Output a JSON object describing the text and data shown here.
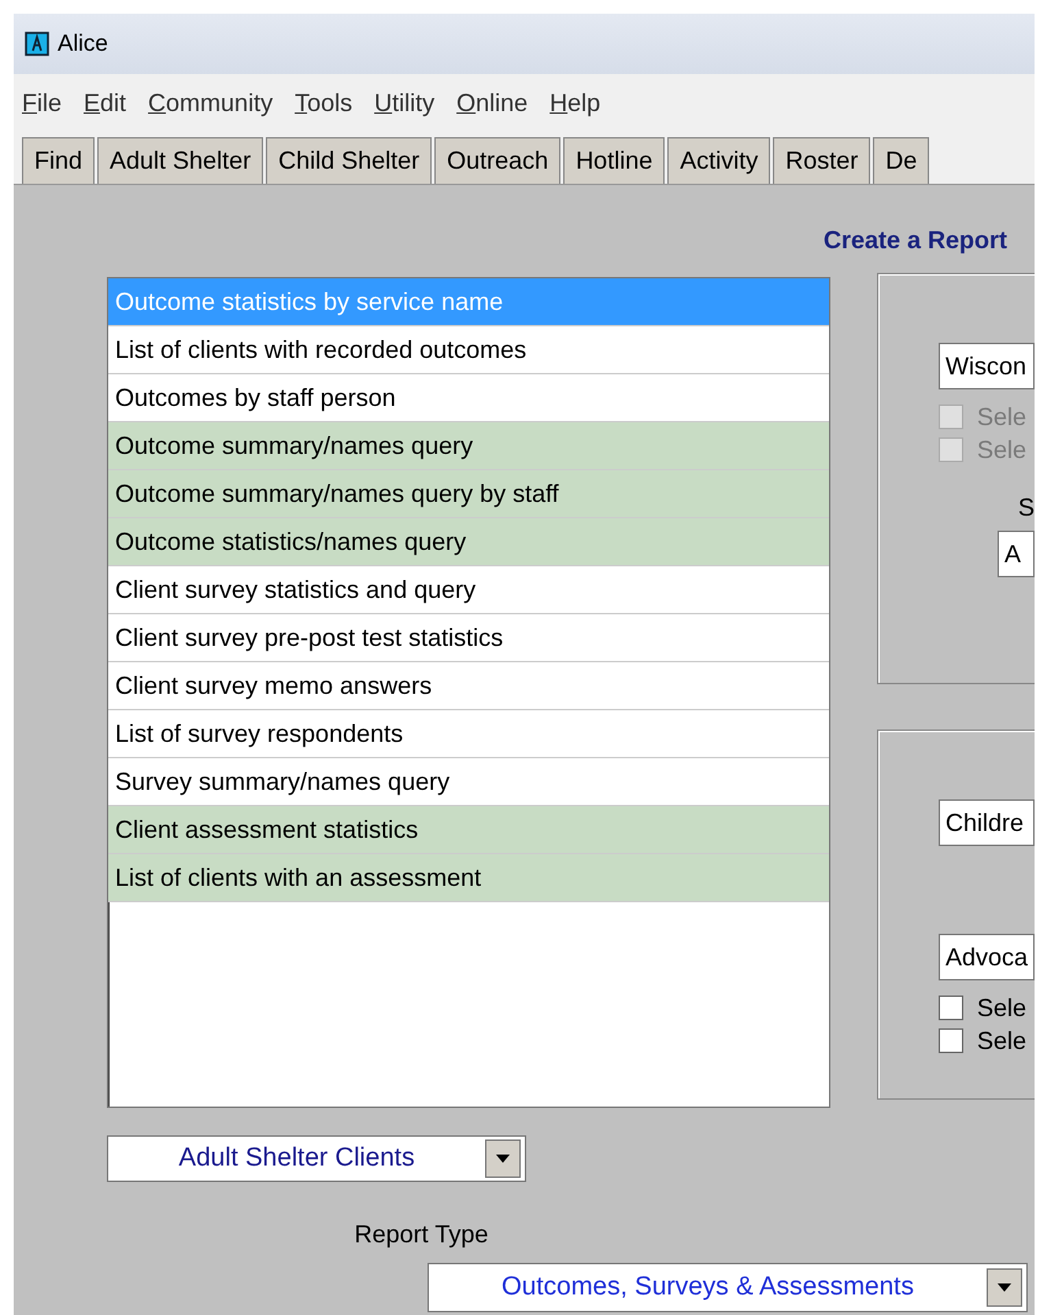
{
  "window": {
    "title": "Alice"
  },
  "menu": [
    {
      "label": "File"
    },
    {
      "label": "Edit"
    },
    {
      "label": "Community"
    },
    {
      "label": "Tools"
    },
    {
      "label": "Utility"
    },
    {
      "label": "Online"
    },
    {
      "label": "Help"
    }
  ],
  "tabs": [
    {
      "label": "Find",
      "selected": false
    },
    {
      "label": "Adult Shelter",
      "selected": false
    },
    {
      "label": "Child Shelter",
      "selected": false
    },
    {
      "label": "Outreach",
      "selected": false
    },
    {
      "label": "Hotline",
      "selected": false
    },
    {
      "label": "Activity",
      "selected": false
    },
    {
      "label": "Roster",
      "selected": false
    },
    {
      "label": "De",
      "selected": false
    }
  ],
  "heading": "Create a Report",
  "reports": [
    {
      "label": "Outcome statistics by service name",
      "selected": true
    },
    {
      "label": "List of clients with recorded outcomes",
      "selected": false,
      "color": "#ffffff"
    },
    {
      "label": "Outcomes by staff person",
      "selected": false,
      "color": "#ffffff"
    },
    {
      "label": "Outcome summary/names query",
      "selected": false,
      "color": "#c8dcc4"
    },
    {
      "label": "Outcome summary/names query by staff",
      "selected": false,
      "color": "#c8dcc4"
    },
    {
      "label": "Outcome statistics/names query",
      "selected": false,
      "color": "#c8dcc4"
    },
    {
      "label": "Client survey statistics and query",
      "selected": false,
      "color": "#ffffff"
    },
    {
      "label": "Client survey pre-post test statistics",
      "selected": false,
      "color": "#ffffff"
    },
    {
      "label": "Client survey memo answers",
      "selected": false,
      "color": "#ffffff"
    },
    {
      "label": "List of survey respondents",
      "selected": false,
      "color": "#ffffff"
    },
    {
      "label": "Survey summary/names query",
      "selected": false,
      "color": "#ffffff"
    },
    {
      "label": "Client assessment statistics",
      "selected": false,
      "color": "#c8dcc4"
    },
    {
      "label": "List of clients with an assessment",
      "selected": false,
      "color": "#c8dcc4"
    }
  ],
  "panel_1": {
    "field_1": "Wiscon",
    "checkboxes": [
      {
        "label": "Sele",
        "checked": false,
        "disabled": true
      },
      {
        "label": "Sele",
        "checked": false,
        "disabled": true
      }
    ],
    "label": "S",
    "field_2": "A"
  },
  "panel_2": {
    "field_1": "Childre",
    "field_2": "Advoca",
    "checkboxes": [
      {
        "label": "Sele",
        "checked": false,
        "disabled": false
      },
      {
        "label": "Sele",
        "checked": false,
        "disabled": false
      }
    ]
  },
  "client_dropdown": "Adult Shelter Clients",
  "report_type": {
    "label": "Report Type",
    "value": "Outcomes, Surveys & Assessments"
  }
}
